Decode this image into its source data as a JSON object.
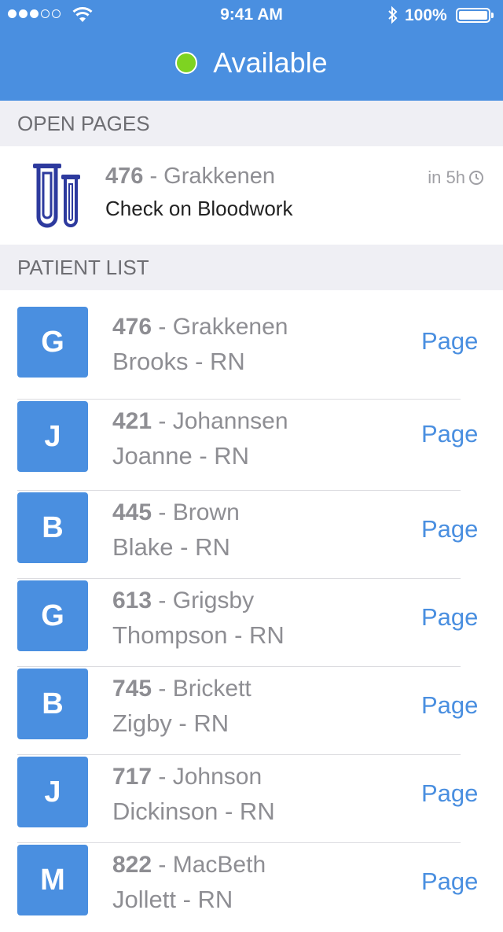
{
  "status_bar": {
    "time": "9:41 AM",
    "battery": "100%",
    "signal_bars": 3,
    "signal_total": 5
  },
  "header": {
    "status_label": "Available",
    "status_color": "#7ed321"
  },
  "colors": {
    "accent": "#4a8fe0"
  },
  "open_pages": {
    "heading": "OPEN PAGES",
    "item": {
      "room": "476",
      "separator": " - ",
      "name": "Grakkenen",
      "task": "Check on Bloodwork",
      "time": "in 5h",
      "icon": "test-tubes-icon"
    }
  },
  "patient_list": {
    "heading": "PATIENT LIST",
    "action_label": "Page",
    "patients": [
      {
        "initial": "G",
        "room": "476",
        "name": "Grakkenen",
        "nurse": "Brooks - RN"
      },
      {
        "initial": "J",
        "room": "421",
        "name": "Johannsen",
        "nurse": "Joanne - RN"
      },
      {
        "initial": "B",
        "room": "445",
        "name": "Brown",
        "nurse": "Blake - RN"
      },
      {
        "initial": "G",
        "room": "613",
        "name": "Grigsby",
        "nurse": "Thompson - RN"
      },
      {
        "initial": "B",
        "room": "745",
        "name": "Brickett",
        "nurse": "Zigby - RN"
      },
      {
        "initial": "J",
        "room": "717",
        "name": "Johnson",
        "nurse": "Dickinson - RN"
      },
      {
        "initial": "M",
        "room": "822",
        "name": "MacBeth",
        "nurse": "Jollett - RN"
      }
    ]
  }
}
